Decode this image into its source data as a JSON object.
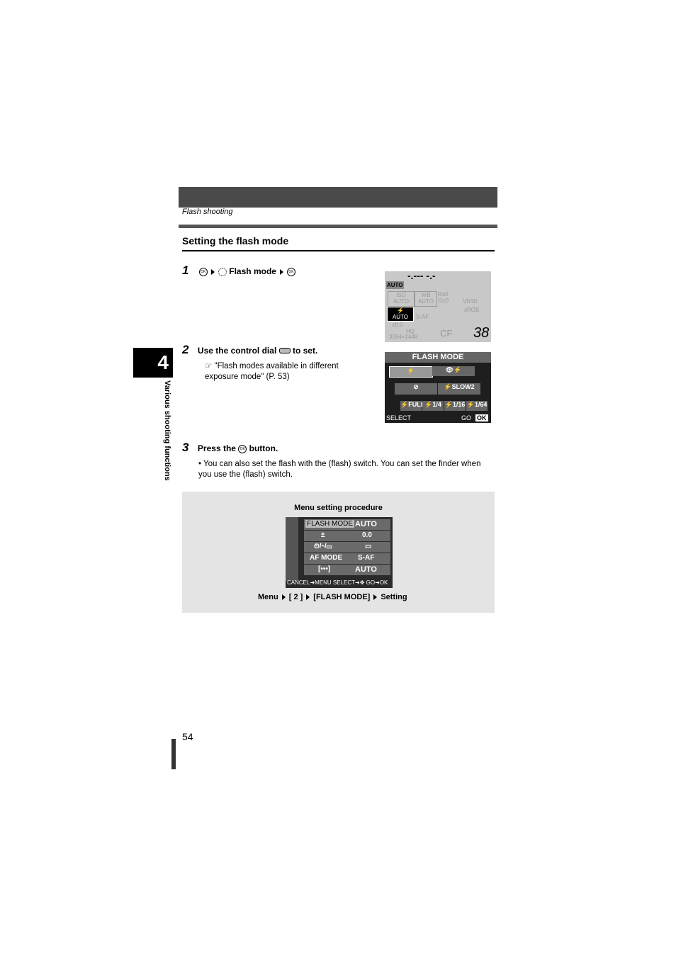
{
  "header": {
    "breadcrumb": "Flash shooting"
  },
  "section_title": "Setting the flash mode",
  "chapter": {
    "number": "4",
    "title": "Various shooting functions"
  },
  "steps": [
    {
      "num": "1",
      "text": "Flash mode"
    },
    {
      "num": "2",
      "text_before": "Use the control dial",
      "text_after": "to set.",
      "ref": "\"Flash modes available in different exposure mode\" (P. 53)"
    },
    {
      "num": "3",
      "text_before": "Press the",
      "text_after": "button.",
      "bullet": "You can also set the flash with the (flash) switch. You can set the finder when you use the (flash) switch."
    }
  ],
  "control_panel": {
    "shutter": "-.--- -.-",
    "mode": "AUTO",
    "iso": "ISO",
    "iso_val": "AUTO",
    "wb": "WB",
    "wb_val": "AUTO",
    "r": "R±0",
    "g": "G±0",
    "vivid": "VIVID",
    "flash_val": "AUTO",
    "saf": "S-AF",
    "srgb": "sRGB",
    "flash_comp": "±0.0",
    "quality": "HQ",
    "size": "3264×2448",
    "card": "CF",
    "frames": "38"
  },
  "flash_menu": {
    "title": "FLASH MODE",
    "options": [
      "⚡",
      "👁⚡",
      "⊘",
      "⚡SLOW2",
      "⚡FULL",
      "⚡1/4",
      "⚡1/16",
      "⚡1/64"
    ],
    "select": "SELECT",
    "go": "GO",
    "ok": "OK"
  },
  "menu_box": {
    "title": "Menu setting procedure",
    "rows": [
      {
        "label": "FLASH MODE",
        "value": "AUTO"
      },
      {
        "label": "±",
        "value": "0.0"
      },
      {
        "label": "⏲/⌁/▭",
        "value": "▭"
      },
      {
        "label": "AF MODE",
        "value": "S-AF"
      },
      {
        "label": "[•••]",
        "value": "AUTO"
      }
    ],
    "footer": "CANCEL➜MENU SELECT➜✥ GO➜OK",
    "path": [
      "Menu",
      "[ 2 ]",
      "[FLASH MODE]",
      "Setting"
    ]
  },
  "page_number": "54"
}
